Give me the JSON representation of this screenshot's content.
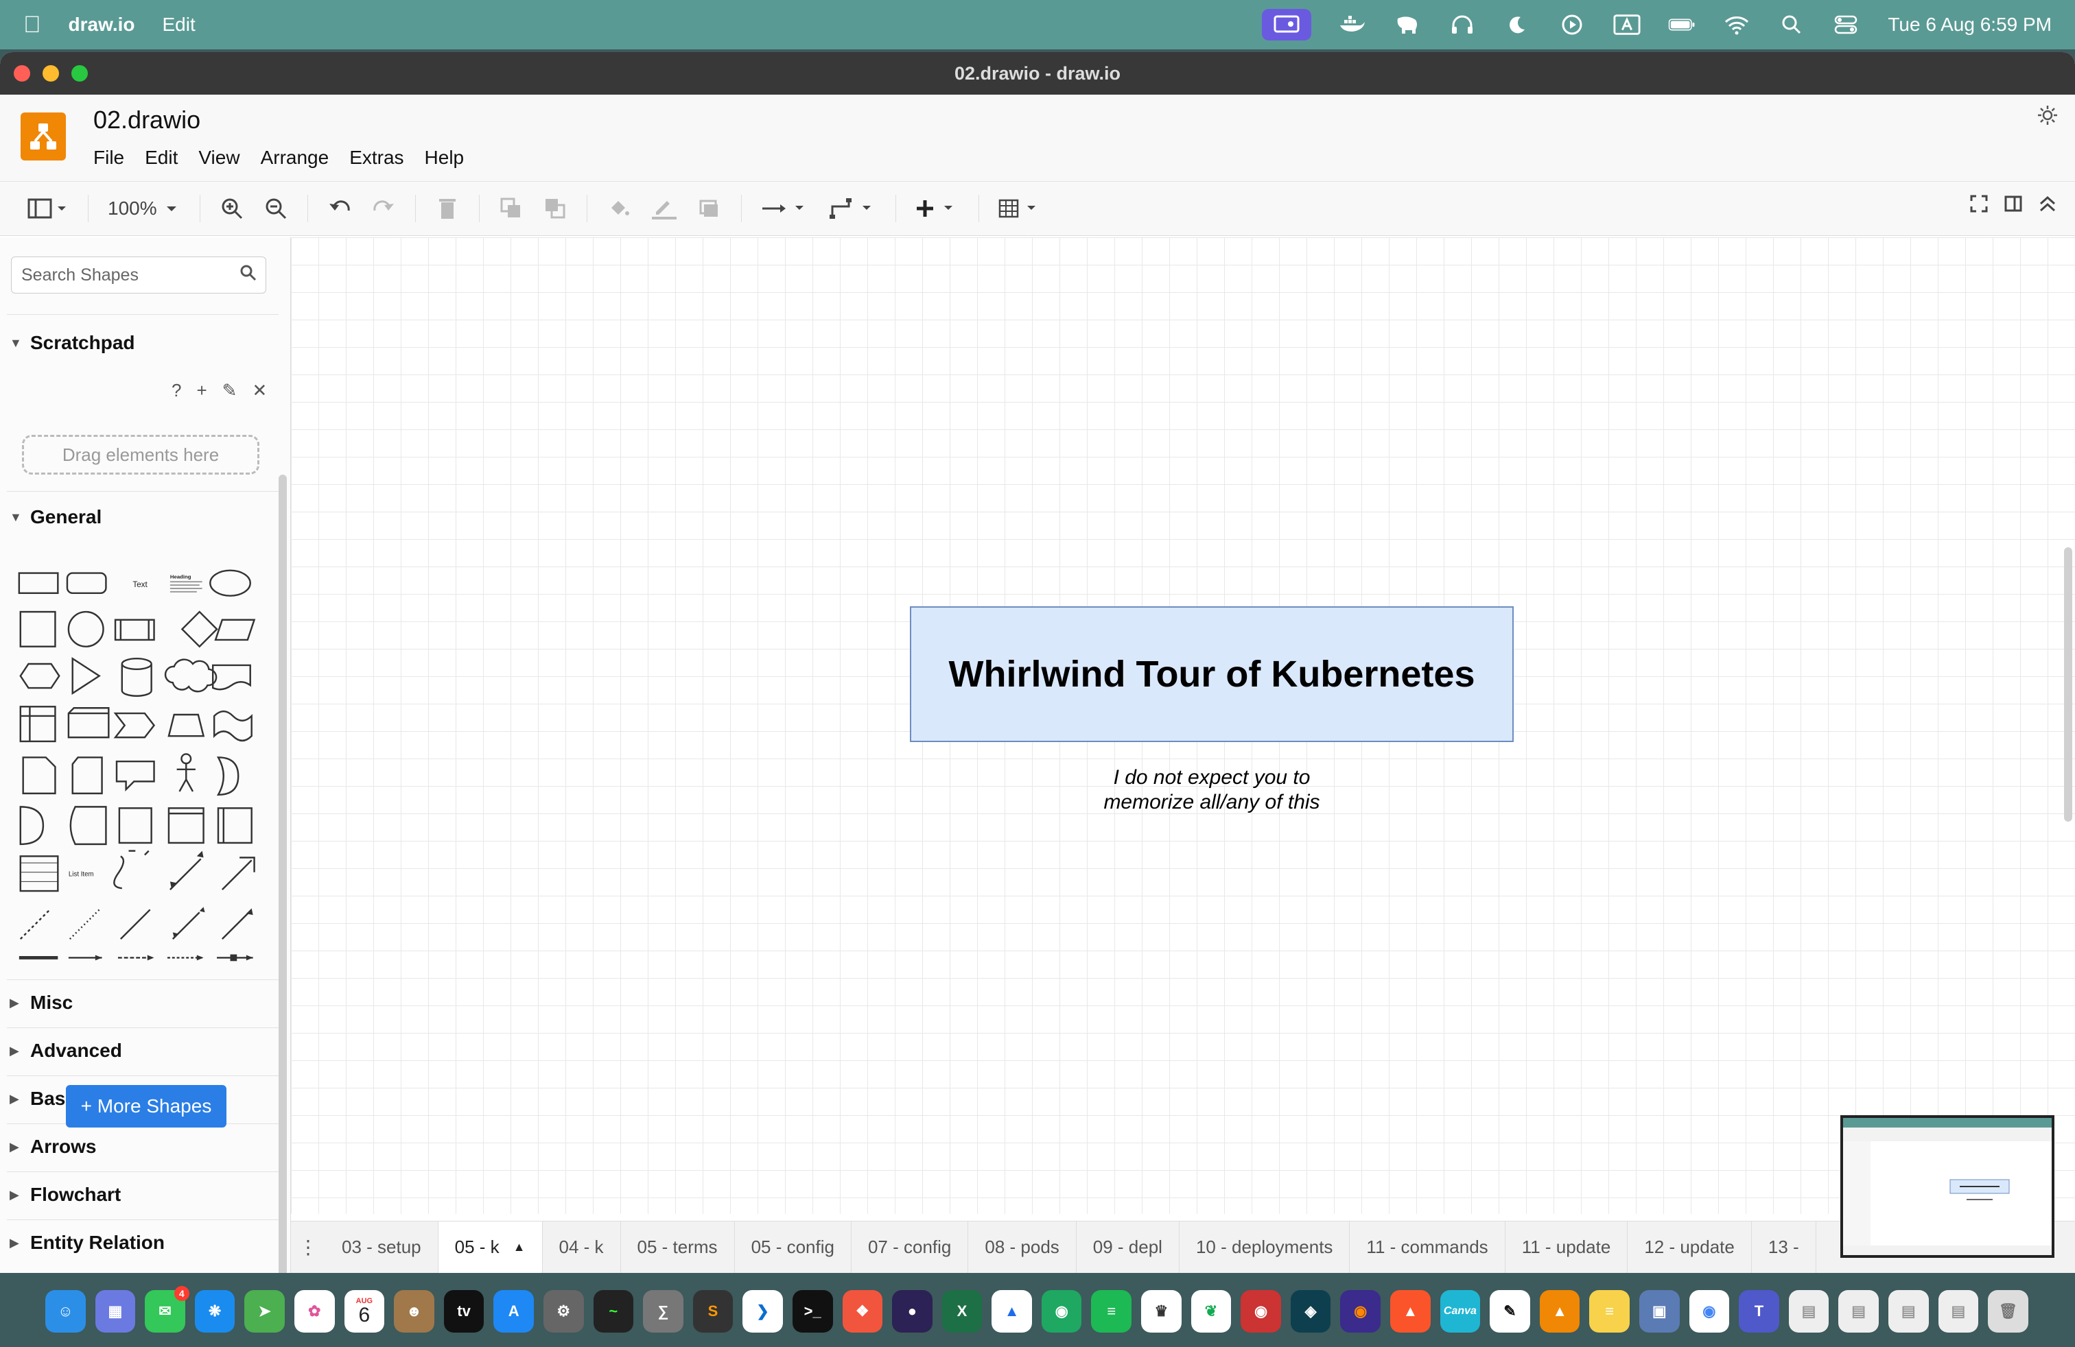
{
  "menubar": {
    "app_name": "draw.io",
    "menu_edit": "Edit",
    "clock": "Tue 6 Aug  6:59 PM"
  },
  "window": {
    "title": "02.drawio - draw.io"
  },
  "app": {
    "doc_name": "02.drawio",
    "menus": [
      "File",
      "Edit",
      "View",
      "Arrange",
      "Extras",
      "Help"
    ]
  },
  "toolbar": {
    "zoom": "100%"
  },
  "sidebar": {
    "search_placeholder": "Search Shapes",
    "scratchpad_label": "Scratchpad",
    "scratchpad_help": "?",
    "drag_hint": "Drag elements here",
    "general_label": "General",
    "shape_text_label": "Text",
    "shape_heading_label": "Heading",
    "shape_list_item_label": "List Item",
    "collapsed_sections": [
      "Misc",
      "Advanced",
      "Basic",
      "Arrows",
      "Flowchart",
      "Entity Relation"
    ],
    "more_shapes": "+ More Shapes"
  },
  "canvas": {
    "title_box": "Whirlwind Tour of Kubernetes",
    "subtitle_line1": "I do not expect you to",
    "subtitle_line2": "memorize all/any of this"
  },
  "tabs": {
    "items": [
      "03 - setup",
      "05 - k",
      "04 - k",
      "05 - terms",
      "05 - config",
      "07 - config",
      "08 - pods",
      "09 - depl",
      "10 - deployments",
      "11 - commands",
      "11 - update",
      "12 - update",
      "13 -"
    ],
    "active_index": 1
  },
  "dock": {
    "calendar_month": "AUG",
    "calendar_day": "6",
    "messages_badge": "4"
  },
  "colors": {
    "accent": "#f08705",
    "title_fill": "#dae8fc",
    "title_stroke": "#6c8ebf",
    "more_shapes_button": "#2a7ee6",
    "menubar": "#5a9a94"
  }
}
